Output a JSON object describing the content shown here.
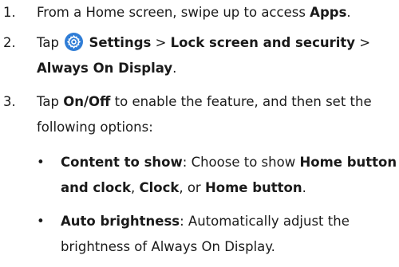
{
  "steps": [
    {
      "num": "1.",
      "pre": "From a Home screen, swipe up to access ",
      "bold": "Apps",
      "post": "."
    },
    {
      "num": "2.",
      "pre": "Tap ",
      "icon": "settings-gear-icon",
      "settings": "Settings",
      "sep1": " > ",
      "lock": "Lock screen and security",
      "sep2": " >",
      "aod": "Always On Display",
      "post": "."
    },
    {
      "num": "3.",
      "pre": "Tap ",
      "onoff": "On/Off",
      "post": " to enable the feature, and then set the following options:"
    }
  ],
  "bullets": [
    {
      "marker": "•",
      "term": "Content to show",
      "a": ": Choose to show ",
      "opt1": "Home button and clock",
      "b": ", ",
      "opt2": "Clock",
      "c": ", or ",
      "opt3": "Home button",
      "d": "."
    },
    {
      "marker": "•",
      "term": "Auto brightness",
      "a": ": Automatically adjust the brightness of Always On Display."
    }
  ],
  "colors": {
    "icon_bg": "#2f7dd6",
    "text": "#1a1a1a"
  }
}
